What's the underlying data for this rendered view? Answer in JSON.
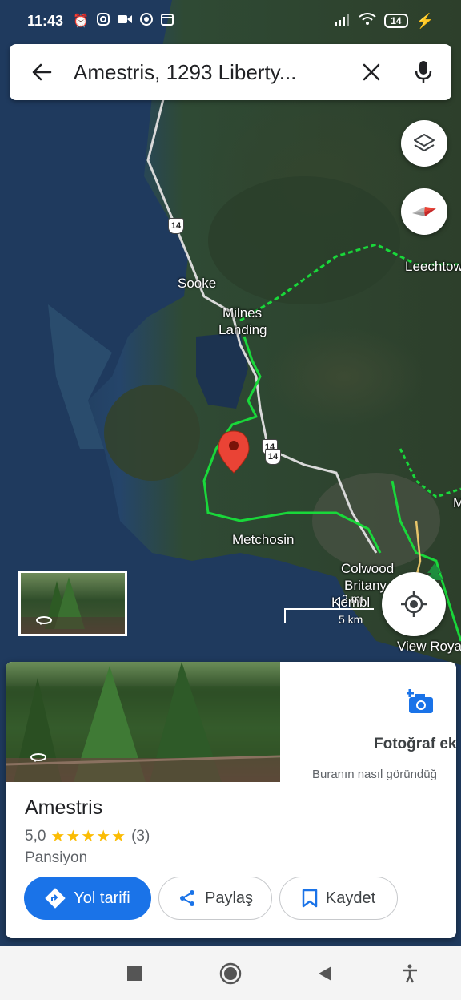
{
  "status_bar": {
    "time": "11:43",
    "battery": "14",
    "icons": [
      "alarm-icon",
      "instagram-icon",
      "video-icon",
      "chrome-icon",
      "calendar-icon"
    ]
  },
  "search": {
    "query": "Amestris, 1293 Liberty..."
  },
  "map": {
    "labels": {
      "sooke": "Sooke",
      "milnes_landing_1": "Milnes",
      "milnes_landing_2": "Landing",
      "leechtown": "Leechtow",
      "metchosin": "Metchosin",
      "colwood": "Colwood",
      "britany": "Britany",
      "kembl": "Kembl",
      "view_royal": "View Roya",
      "m_edge": "M"
    },
    "highway_14": "14",
    "scale": {
      "miles": "2 mi",
      "km": "5 km"
    }
  },
  "place_card": {
    "add_photo_title": "Fotoğraf ek",
    "add_photo_subtitle": "Buranın nasıl göründüğ",
    "name": "Amestris",
    "rating_value": "5,0",
    "stars": "★★★★★",
    "review_count": "(3)",
    "category": "Pansiyon",
    "buttons": {
      "directions": "Yol tarifi",
      "share": "Paylaş",
      "save": "Kaydet"
    }
  },
  "colors": {
    "accent_blue": "#1a73e8",
    "pin_red": "#ea4335",
    "star_yellow": "#fbbc04",
    "trail_green": "#19d83a"
  }
}
